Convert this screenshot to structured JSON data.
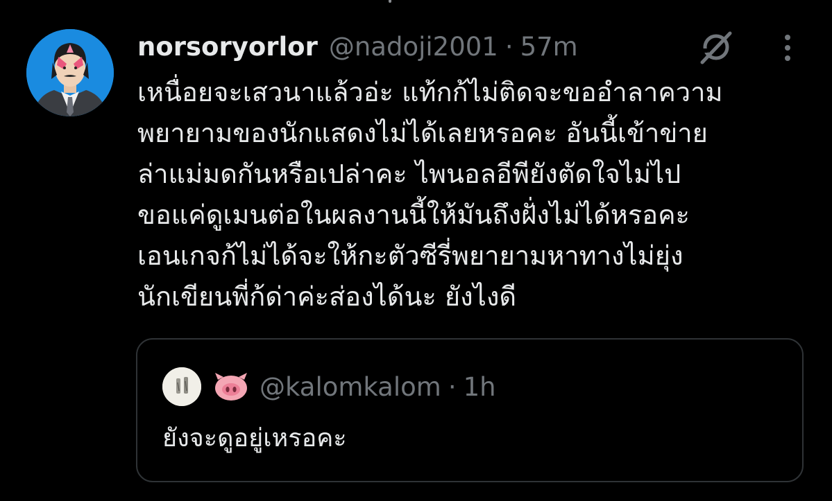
{
  "tweet": {
    "author": {
      "display_name": "norsoryorlor",
      "handle": "@nadoji2001",
      "separator": "·",
      "time": "57m"
    },
    "text_lines": [
      "เหนื่อยจะเสวนาแล้วอ่ะ แท้กก้ไม่ติดจะขออำลาความ",
      "พยายามของนักแสดงไม่ได้เลยหรอคะ อันนี้เข้าข่าย",
      "ล่าแม่มดกันหรือเปล่าคะ ไพนอลอีพียังตัดใจไม่ไป",
      "ขอแค่ดูเมนต่อในผลงานนี้ให้มันถึงฝั่งไม่ได้หรอคะ",
      "เอนเกจก้ไม่ได้จะให้กะตัวซีรี่พยายามหาทางไม่ยุ่ง",
      "นักเขียนพี่ก้ด่าค่ะส่องได้นะ ยังไงดี"
    ],
    "icons": {
      "grok": "grok-icon",
      "more": "more-vertical-icon"
    }
  },
  "quote": {
    "author": {
      "handle": "@kalomkalom",
      "separator": "·",
      "time": "1h",
      "emoji_icon": "pig-nose-icon"
    },
    "text": "ยังจะดูอยู่เหรอคะ"
  },
  "colors": {
    "background": "#000000",
    "primary_text": "#e7e9ea",
    "secondary_text": "#71767b",
    "border": "#2f3336",
    "avatar_bg": "#1a8be0",
    "pig_pink": "#f4a6b4"
  }
}
